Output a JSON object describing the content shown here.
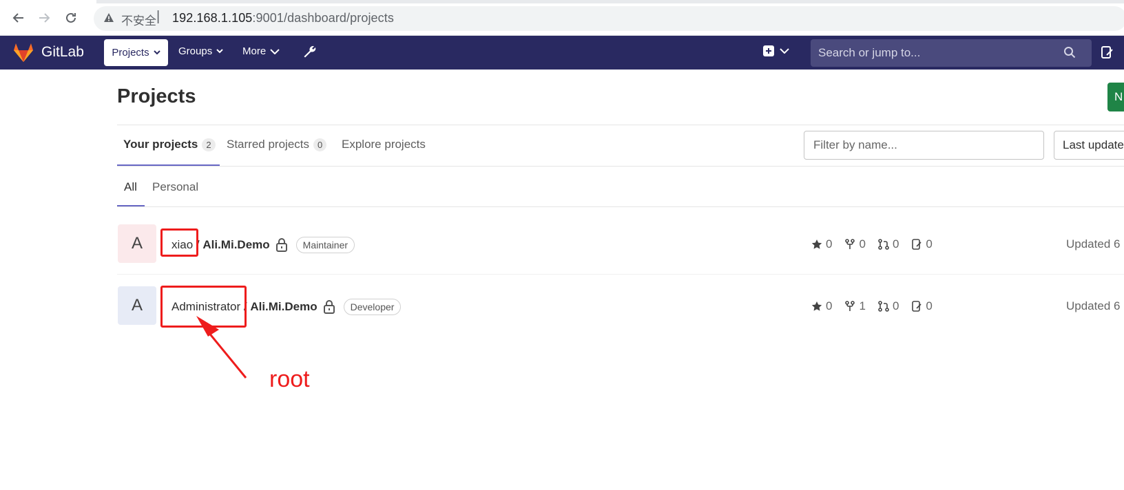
{
  "browser": {
    "insecure_label": "不安全",
    "separator": "|",
    "url_host": "192.168.1.105",
    "url_rest": ":9001/dashboard/projects"
  },
  "navbar": {
    "brand": "GitLab",
    "projects": "Projects",
    "groups": "Groups",
    "more": "More",
    "search_placeholder": "Search or jump to..."
  },
  "page": {
    "title": "Projects",
    "new_button": "N"
  },
  "tabs": [
    {
      "label": "Your projects",
      "count": "2"
    },
    {
      "label": "Starred projects",
      "count": "0"
    },
    {
      "label": "Explore projects"
    }
  ],
  "filter": {
    "placeholder": "Filter by name...",
    "sort": "Last updated"
  },
  "subtabs": [
    "All",
    "Personal"
  ],
  "projects": [
    {
      "avatar": "A",
      "namespace": "xiao",
      "separator": " / ",
      "name": "Ali.Mi.Demo",
      "role": "Maintainer",
      "stars": "0",
      "forks": "0",
      "merge_requests": "0",
      "issues": "0",
      "updated": "Updated 6"
    },
    {
      "avatar": "A",
      "namespace": "Administrator",
      "separator": " / ",
      "name": "Ali.Mi.Demo",
      "role": "Developer",
      "stars": "0",
      "forks": "1",
      "merge_requests": "0",
      "issues": "0",
      "updated": "Updated 6"
    }
  ],
  "annotation": {
    "text": "root",
    "color": "#ee1c1c"
  },
  "colors": {
    "navbar": "#292961",
    "new_button": "#1f8446"
  }
}
